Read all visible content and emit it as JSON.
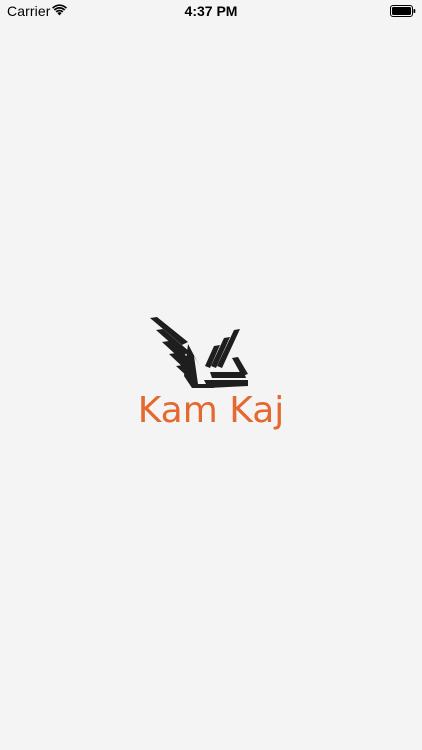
{
  "status_bar": {
    "carrier": "Carrier",
    "time": "4:37 PM",
    "wifi_icon": "wifi-icon",
    "battery_icon": "battery-full-icon"
  },
  "splash": {
    "logo_icon": "eagle-wings-logo",
    "brand_name": "Kam Kaj",
    "brand_color": "#e4682f",
    "logo_color": "#1e1e1e",
    "background_color": "#f4f4f4"
  }
}
